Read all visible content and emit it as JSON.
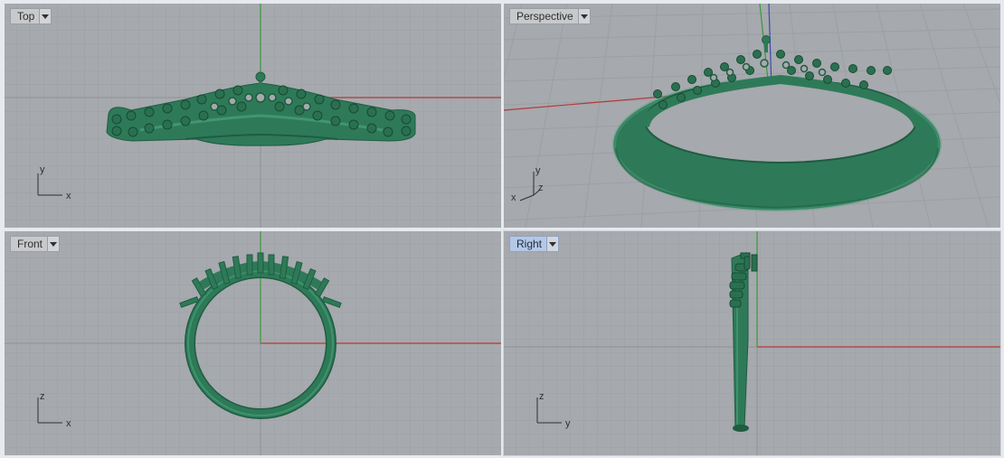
{
  "viewports": {
    "top": {
      "label": "Top",
      "axis1": "y",
      "axis2": "x"
    },
    "perspective": {
      "label": "Perspective",
      "axis1": "y",
      "axis2": "z",
      "axis3": "x"
    },
    "front": {
      "label": "Front",
      "axis1": "z",
      "axis2": "x"
    },
    "right": {
      "label": "Right",
      "axis1": "z",
      "axis2": "y",
      "active": true
    }
  },
  "colors": {
    "background": "#a6a9ad",
    "grid_minor": "#9b9ea3",
    "grid_major": "#8d9095",
    "x_axis": "#b23a3a",
    "y_axis": "#3a9a3a",
    "z_axis": "#3a4ab0",
    "model": "#2e7a58",
    "model_dark": "#1f5c41",
    "model_light": "#4aa37c"
  },
  "icons": {
    "viewport_menu": "chevron-down-icon",
    "model": "ring-model"
  }
}
